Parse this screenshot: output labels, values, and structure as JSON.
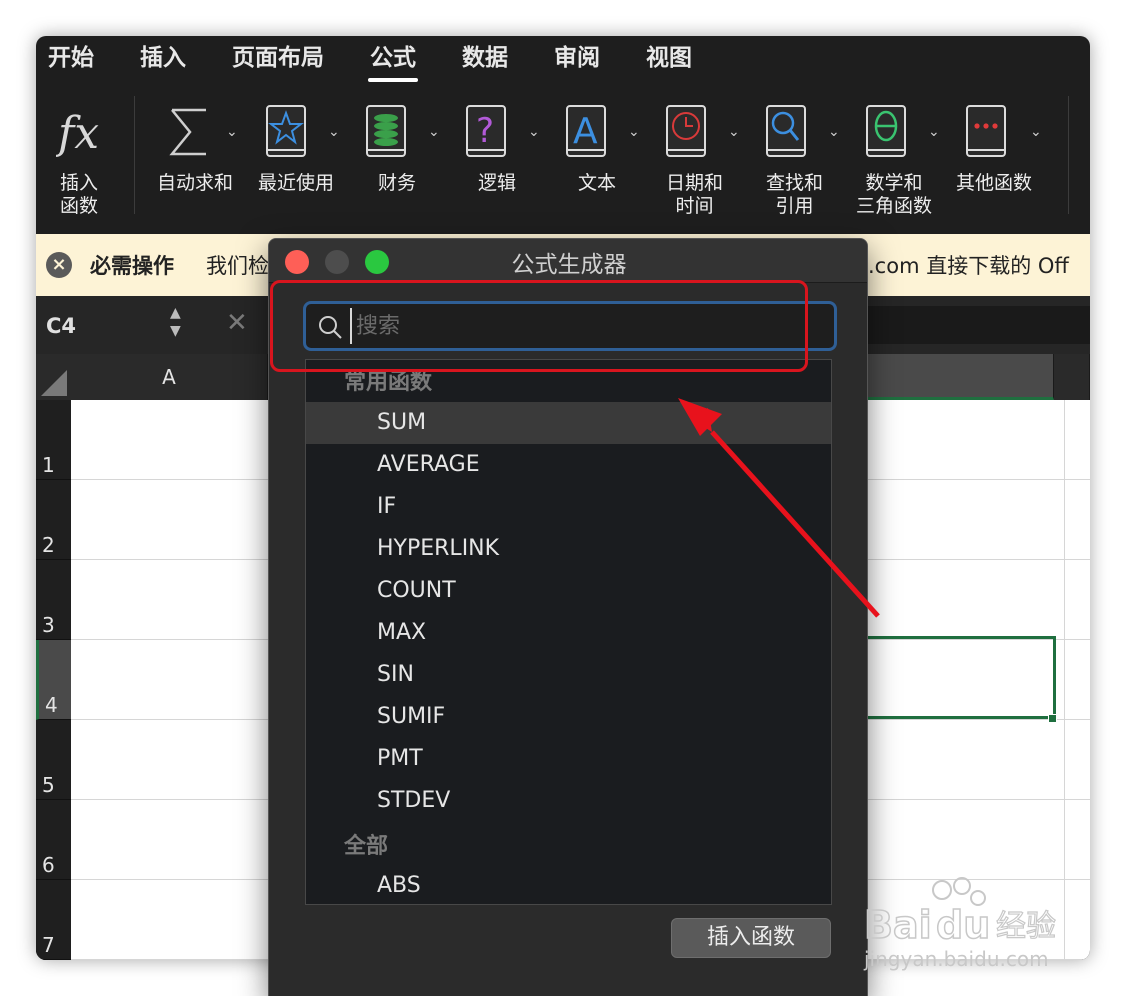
{
  "menu_tabs": [
    "开始",
    "插入",
    "页面布局",
    "公式",
    "数据",
    "审阅",
    "视图"
  ],
  "active_tab": "公式",
  "ribbon": {
    "insert_function": [
      "插入",
      "函数"
    ],
    "autosum": "自动求和",
    "recent": "最近使用",
    "finance": "财务",
    "logic": "逻辑",
    "text": "文本",
    "datetime": [
      "日期和",
      "时间"
    ],
    "lookup": [
      "查找和",
      "引用"
    ],
    "math": [
      "数学和",
      "三角函数"
    ],
    "other": "其他函数"
  },
  "notification": {
    "title": "必需操作",
    "text": "我们检",
    "tail": ".com 直接下载的 Off"
  },
  "formula_bar": {
    "name_box": "C4"
  },
  "grid": {
    "column_a": "A",
    "rows": [
      "1",
      "2",
      "3",
      "4",
      "5",
      "6",
      "7"
    ],
    "selected_row": "4"
  },
  "dialog": {
    "title": "公式生成器",
    "search_placeholder": "搜索",
    "common_heading": "常用函数",
    "common_functions": [
      "SUM",
      "AVERAGE",
      "IF",
      "HYPERLINK",
      "COUNT",
      "MAX",
      "SIN",
      "SUMIF",
      "PMT",
      "STDEV"
    ],
    "selected_function": "SUM",
    "all_heading": "全部",
    "all_functions": [
      "ABS"
    ],
    "insert_button": "插入函数"
  },
  "colors": {
    "accent_search": "#2f5f96",
    "annotation": "#d8151e",
    "selection_green": "#1f6f3f",
    "notification_bg": "#fdf3d6"
  },
  "watermark": {
    "brand": "Bai",
    "brand2": "du",
    "cn": "经验",
    "url": "jingyan.baidu.com"
  }
}
